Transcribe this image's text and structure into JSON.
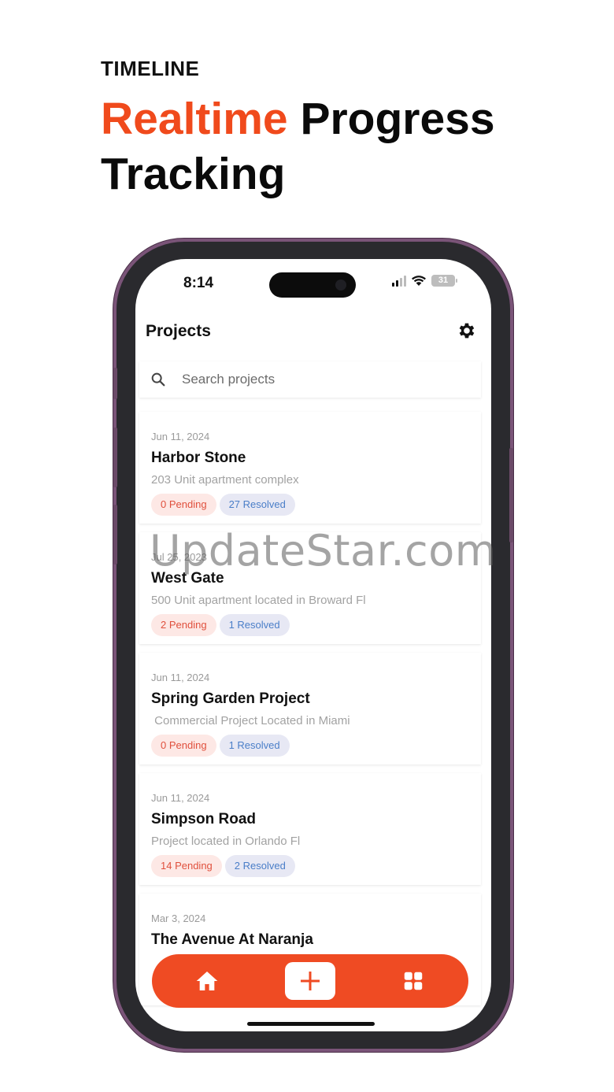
{
  "marketing": {
    "eyebrow": "TIMELINE",
    "headline_accent": "Realtime",
    "headline_rest": " Progress",
    "headline_line2": "Tracking",
    "accent_color": "#f04a1c"
  },
  "status_bar": {
    "time": "8:14",
    "battery": "31"
  },
  "header": {
    "title": "Projects",
    "settings_icon": "gear-icon"
  },
  "search": {
    "placeholder": "Search projects",
    "value": ""
  },
  "projects": [
    {
      "date": "Jun 11, 2024",
      "name": "Harbor Stone",
      "description": "203 Unit apartment complex",
      "pending": "0 Pending",
      "resolved": "27 Resolved"
    },
    {
      "date": "Jul 25, 2023",
      "name": "West Gate",
      "description": "500 Unit apartment located in Broward Fl",
      "pending": "2 Pending",
      "resolved": "1 Resolved"
    },
    {
      "date": "Jun 11, 2024",
      "name": "Spring Garden Project",
      "description": " Commercial Project Located in Miami",
      "pending": "0 Pending",
      "resolved": "1 Resolved"
    },
    {
      "date": "Jun 11, 2024",
      "name": "Simpson Road",
      "description": "Project located in Orlando Fl",
      "pending": "14 Pending",
      "resolved": "2 Resolved"
    },
    {
      "date": "Mar 3, 2024",
      "name": "The Avenue At Naranja",
      "description": "",
      "pending": "",
      "resolved": ""
    }
  ],
  "bottom_nav": {
    "home_icon": "home-icon",
    "add_icon": "plus-icon",
    "grid_icon": "grid-icon",
    "bar_color": "#ef4b23"
  },
  "watermark": "UpdateStar.com"
}
